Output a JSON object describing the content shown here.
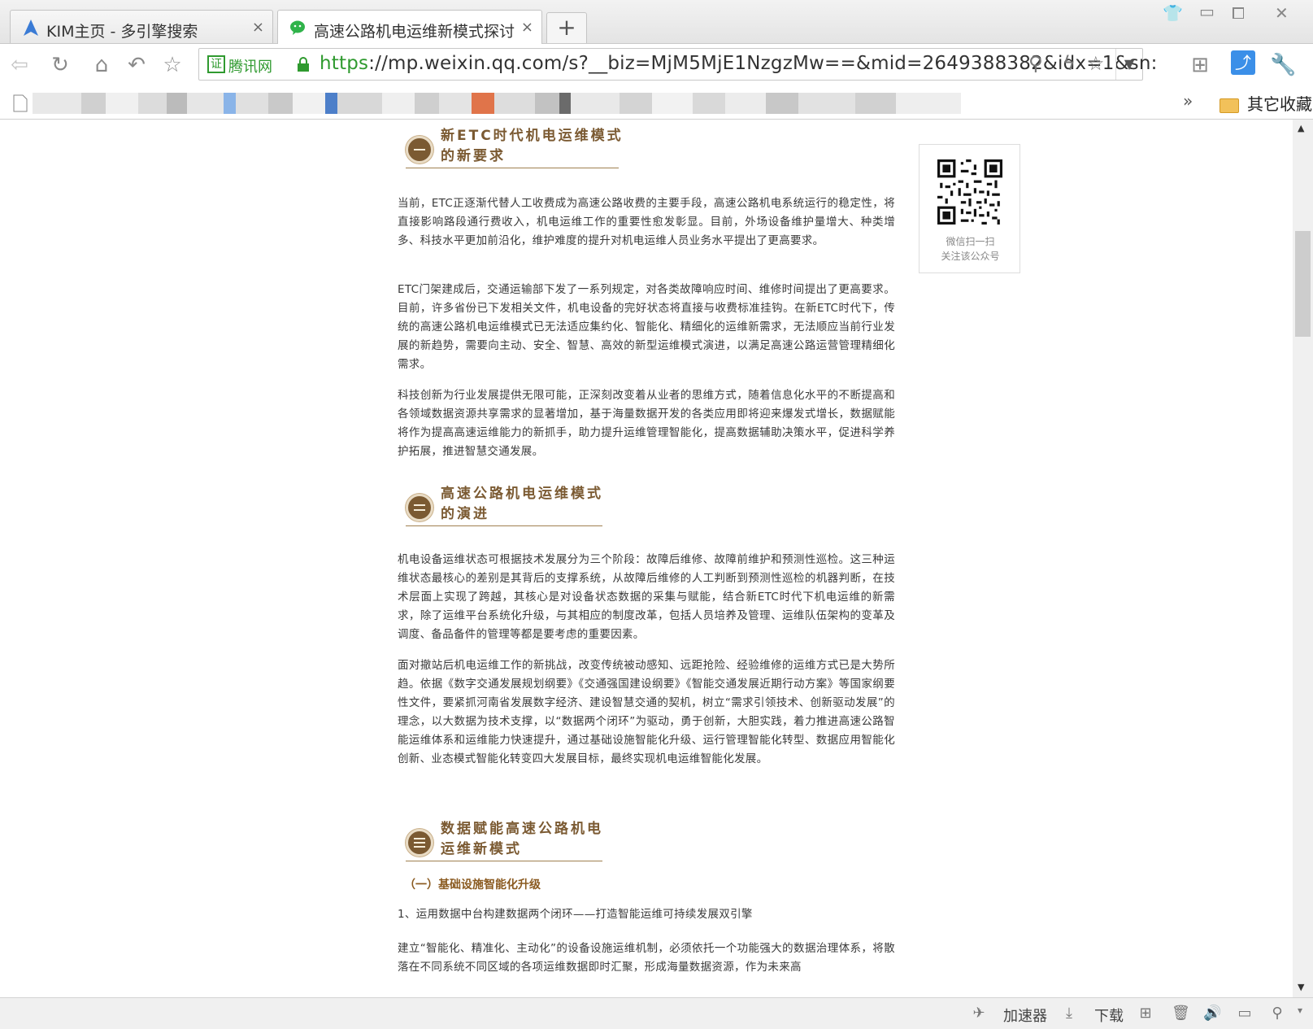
{
  "browser": {
    "tabs": [
      {
        "label": "KIM主页 - 多引擎搜索",
        "icon": "kim-logo-icon",
        "close": "×"
      },
      {
        "label": "高速公路机电运维新模式探讨",
        "icon": "wechat-icon",
        "close": "×"
      }
    ],
    "new_tab": "+",
    "cert_box": "证",
    "cert_label": "腾讯网",
    "url_scheme": "https",
    "url_rest": "://mp.weixin.qq.com/s?__biz=MjM5MjE1NzgzMw==&mid=2649388382&idx=1&sn:",
    "bookmarks_more": "»",
    "bookmarks_folder": "其它收藏"
  },
  "article": {
    "sections": [
      {
        "title_line1": "新ETC时代机电运维模式",
        "title_line2": "的新要求"
      },
      {
        "title_line1": "高速公路机电运维模式",
        "title_line2": "的演进"
      },
      {
        "title_line1": "数据赋能高速公路机电",
        "title_line2": "运维新模式"
      }
    ],
    "paragraphs": [
      "当前，ETC正逐渐代替人工收费成为高速公路收费的主要手段，高速公路机电系统运行的稳定性，将直接影响路段通行费收入，机电运维工作的重要性愈发彰显。目前，外场设备维护量增大、种类增多、科技水平更加前沿化，维护难度的提升对机电运维人员业务水平提出了更高要求。",
      "ETC门架建成后，交通运输部下发了一系列规定，对各类故障响应时间、维修时间提出了更高要求。目前，许多省份已下发相关文件，机电设备的完好状态将直接与收费标准挂钩。在新ETC时代下，传统的高速公路机电运维模式已无法适应集约化、智能化、精细化的运维新需求，无法顺应当前行业发展的新趋势，需要向主动、安全、智慧、高效的新型运维模式演进，以满足高速公路运营管理精细化需求。",
      "科技创新为行业发展提供无限可能，正深刻改变着从业者的思维方式，随着信息化水平的不断提高和各领域数据资源共享需求的显著增加，基于海量数据开发的各类应用即将迎来爆发式增长，数据赋能将作为提高高速运维能力的新抓手，助力提升运维管理智能化，提高数据辅助决策水平，促进科学养护拓展，推进智慧交通发展。",
      "机电设备运维状态可根据技术发展分为三个阶段：故障后维修、故障前维护和预测性巡检。这三种运维状态最核心的差别是其背后的支撑系统，从故障后维修的人工判断到预测性巡检的机器判断，在技术层面上实现了跨越，其核心是对设备状态数据的采集与赋能，结合新ETC时代下机电运维的新需求，除了运维平台系统化升级，与其相应的制度改革，包括人员培养及管理、运维队伍架构的变革及调度、备品备件的管理等都是要考虑的重要因素。",
      "面对撤站后机电运维工作的新挑战，改变传统被动感知、远距抢险、经验维修的运维方式已是大势所趋。依据《数字交通发展规划纲要》《交通强国建设纲要》《智能交通发展近期行动方案》等国家纲要性文件，要紧抓河南省发展数字经济、建设智慧交通的契机，树立“需求引领技术、创新驱动发展”的理念，以大数据为技术支撑，以“数据两个闭环”为驱动，勇于创新，大胆实践，着力推进高速公路智能运维体系和运维能力快速提升，通过基础设施智能化升级、运行管理智能化转型、数据应用智能化创新、业态模式智能化转变四大发展目标，最终实现机电运维智能化发展。",
      "1、运用数据中台构建数据两个闭环——打造智能运维可持续发展双引擎",
      "建立“智能化、精准化、主动化”的设备设施运维机制，必须依托一个功能强大的数据治理体系，将散落在不同系统不同区域的各项运维数据即时汇聚，形成海量数据资源，作为未来高"
    ],
    "subheading": "（一）基础设施智能化升级"
  },
  "qr": {
    "caption_line1": "微信扫一扫",
    "caption_line2": "关注该公众号"
  },
  "statusbar": {
    "accelerator": "加速器",
    "download": "下载"
  },
  "colors": {
    "accent_brown": "#7b5a32",
    "url_green": "#2f9a2f"
  }
}
